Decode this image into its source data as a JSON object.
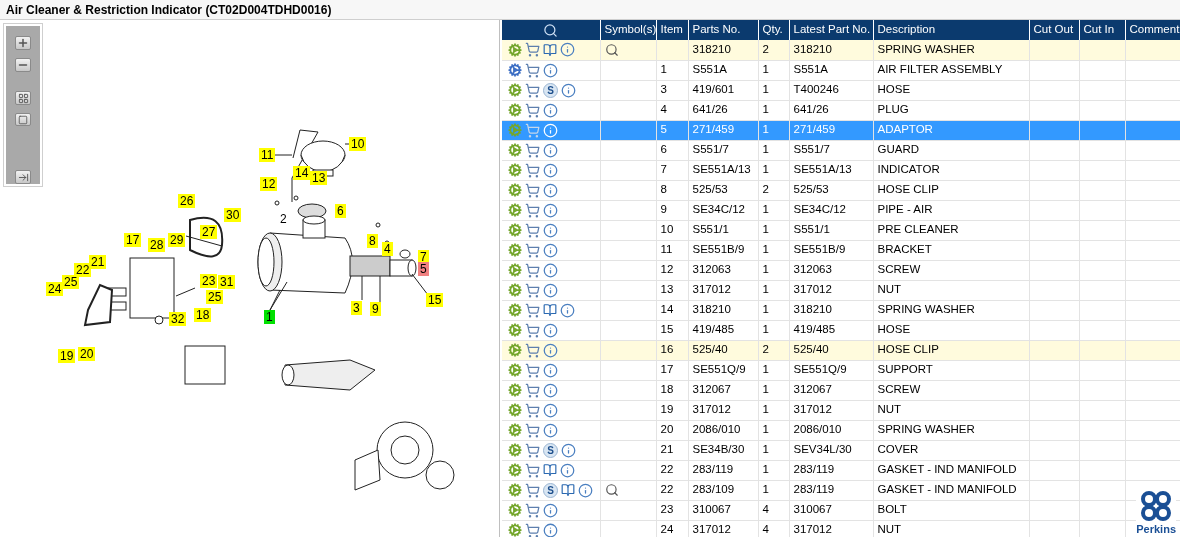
{
  "window": {
    "title": "Air Cleaner & Restriction Indicator (CT02D004TDHD0016)"
  },
  "diagram": {
    "callouts": [
      {
        "text": "10",
        "kind": "tag",
        "color": "#ffff00"
      },
      {
        "text": "11",
        "kind": "tag",
        "color": "#ffff00"
      },
      {
        "text": "12",
        "kind": "tag",
        "color": "#ffff00"
      },
      {
        "text": "14",
        "kind": "tag",
        "color": "#ffff00"
      },
      {
        "text": "13",
        "kind": "tag",
        "color": "#ffff00"
      },
      {
        "text": "6",
        "kind": "tag",
        "color": "#ffff00"
      },
      {
        "text": "2",
        "kind": "plain"
      },
      {
        "text": "26",
        "kind": "tag",
        "color": "#ffff00"
      },
      {
        "text": "30",
        "kind": "tag",
        "color": "#ffff00"
      },
      {
        "text": "27",
        "kind": "tag",
        "color": "#ffff00"
      },
      {
        "text": "29",
        "kind": "tag",
        "color": "#ffff00"
      },
      {
        "text": "28",
        "kind": "tag",
        "color": "#ffff00"
      },
      {
        "text": "17",
        "kind": "tag",
        "color": "#ffff00"
      },
      {
        "text": "21",
        "kind": "tag",
        "color": "#ffff00"
      },
      {
        "text": "22",
        "kind": "tag",
        "color": "#ffff00"
      },
      {
        "text": "25",
        "kind": "tag",
        "color": "#ffff00"
      },
      {
        "text": "24",
        "kind": "tag",
        "color": "#ffff00"
      },
      {
        "text": "23",
        "kind": "tag",
        "color": "#ffff00"
      },
      {
        "text": "31",
        "kind": "tag",
        "color": "#ffff00"
      },
      {
        "text": "25",
        "kind": "tag",
        "color": "#ffff00"
      },
      {
        "text": "18",
        "kind": "tag",
        "color": "#ffff00"
      },
      {
        "text": "32",
        "kind": "tag",
        "color": "#ffff00"
      },
      {
        "text": "19",
        "kind": "tag",
        "color": "#ffff00"
      },
      {
        "text": "20",
        "kind": "tag",
        "color": "#ffff00"
      },
      {
        "text": "8",
        "kind": "tag",
        "color": "#ffff00"
      },
      {
        "text": "4",
        "kind": "tag",
        "color": "#ffff00"
      },
      {
        "text": "7",
        "kind": "tag",
        "color": "#ffff00"
      },
      {
        "text": "5",
        "kind": "tag",
        "color": "#f08080"
      },
      {
        "text": "3",
        "kind": "tag",
        "color": "#ffff00"
      },
      {
        "text": "9",
        "kind": "tag",
        "color": "#ffff00"
      },
      {
        "text": "15",
        "kind": "tag",
        "color": "#ffff00"
      },
      {
        "text": "1",
        "kind": "tag",
        "color": "#00e000"
      }
    ]
  },
  "table": {
    "columns": [
      "Symbol(s)",
      "Item",
      "Parts No.",
      "Qty.",
      "Latest Part No.",
      "Description",
      "Cut Out",
      "Cut In",
      "Comment"
    ],
    "rows": [
      {
        "kind": "part",
        "book": true,
        "symbol": true,
        "highlighted": true,
        "selected": false,
        "parts_no": "318210",
        "qty": "2",
        "latest": "318210",
        "description": "SPRING WASHER"
      },
      {
        "kind": "assembly",
        "book": false,
        "symbol": false,
        "highlighted": false,
        "selected": false,
        "item": "1",
        "parts_no": "S551A",
        "qty": "1",
        "latest": "S551A",
        "description": "AIR FILTER ASSEMBLY"
      },
      {
        "kind": "part",
        "service": "S",
        "book": false,
        "symbol": false,
        "highlighted": false,
        "selected": false,
        "item": "3",
        "parts_no": "419/601",
        "qty": "1",
        "latest": "T400246",
        "description": "HOSE"
      },
      {
        "kind": "part",
        "book": false,
        "symbol": false,
        "highlighted": false,
        "selected": false,
        "item": "4",
        "parts_no": "641/26",
        "qty": "1",
        "latest": "641/26",
        "description": "PLUG"
      },
      {
        "kind": "part",
        "book": false,
        "symbol": false,
        "highlighted": false,
        "selected": true,
        "item": "5",
        "parts_no": "271/459",
        "qty": "1",
        "latest": "271/459",
        "description": "ADAPTOR"
      },
      {
        "kind": "part",
        "book": false,
        "symbol": false,
        "highlighted": false,
        "selected": false,
        "item": "6",
        "parts_no": "S551/7",
        "qty": "1",
        "latest": "S551/7",
        "description": "GUARD"
      },
      {
        "kind": "part",
        "book": false,
        "symbol": false,
        "highlighted": false,
        "selected": false,
        "item": "7",
        "parts_no": "SE551A/13",
        "qty": "1",
        "latest": "SE551A/13",
        "description": "INDICATOR"
      },
      {
        "kind": "part",
        "book": false,
        "symbol": false,
        "highlighted": false,
        "selected": false,
        "item": "8",
        "parts_no": "525/53",
        "qty": "2",
        "latest": "525/53",
        "description": "HOSE CLIP"
      },
      {
        "kind": "part",
        "book": false,
        "symbol": false,
        "highlighted": false,
        "selected": false,
        "item": "9",
        "parts_no": "SE34C/12",
        "qty": "1",
        "latest": "SE34C/12",
        "description": "PIPE - AIR"
      },
      {
        "kind": "part",
        "book": false,
        "symbol": false,
        "highlighted": false,
        "selected": false,
        "item": "10",
        "parts_no": "S551/1",
        "qty": "1",
        "latest": "S551/1",
        "description": "PRE CLEANER"
      },
      {
        "kind": "part",
        "book": false,
        "symbol": false,
        "highlighted": false,
        "selected": false,
        "item": "11",
        "parts_no": "SE551B/9",
        "qty": "1",
        "latest": "SE551B/9",
        "description": "BRACKET"
      },
      {
        "kind": "part",
        "book": false,
        "symbol": false,
        "highlighted": false,
        "selected": false,
        "item": "12",
        "parts_no": "312063",
        "qty": "1",
        "latest": "312063",
        "description": "SCREW"
      },
      {
        "kind": "part",
        "book": false,
        "symbol": false,
        "highlighted": false,
        "selected": false,
        "item": "13",
        "parts_no": "317012",
        "qty": "1",
        "latest": "317012",
        "description": "NUT"
      },
      {
        "kind": "part",
        "book": true,
        "symbol": false,
        "highlighted": false,
        "selected": false,
        "item": "14",
        "parts_no": "318210",
        "qty": "1",
        "latest": "318210",
        "description": "SPRING WASHER"
      },
      {
        "kind": "part",
        "book": false,
        "symbol": false,
        "highlighted": false,
        "selected": false,
        "item": "15",
        "parts_no": "419/485",
        "qty": "1",
        "latest": "419/485",
        "description": "HOSE"
      },
      {
        "kind": "part",
        "book": false,
        "symbol": false,
        "highlighted": true,
        "selected": false,
        "item": "16",
        "parts_no": "525/40",
        "qty": "2",
        "latest": "525/40",
        "description": "HOSE CLIP"
      },
      {
        "kind": "part",
        "book": false,
        "symbol": false,
        "highlighted": false,
        "selected": false,
        "item": "17",
        "parts_no": "SE551Q/9",
        "qty": "1",
        "latest": "SE551Q/9",
        "description": "SUPPORT"
      },
      {
        "kind": "part",
        "book": false,
        "symbol": false,
        "highlighted": false,
        "selected": false,
        "item": "18",
        "parts_no": "312067",
        "qty": "1",
        "latest": "312067",
        "description": "SCREW"
      },
      {
        "kind": "part",
        "book": false,
        "symbol": false,
        "highlighted": false,
        "selected": false,
        "item": "19",
        "parts_no": "317012",
        "qty": "1",
        "latest": "317012",
        "description": "NUT"
      },
      {
        "kind": "part",
        "book": false,
        "symbol": false,
        "highlighted": false,
        "selected": false,
        "item": "20",
        "parts_no": "2086/010",
        "qty": "1",
        "latest": "2086/010",
        "description": "SPRING WASHER"
      },
      {
        "kind": "part",
        "service": "S",
        "book": false,
        "symbol": false,
        "highlighted": false,
        "selected": false,
        "item": "21",
        "parts_no": "SE34B/30",
        "qty": "1",
        "latest": "SEV34L/30",
        "description": "COVER"
      },
      {
        "kind": "part",
        "book": true,
        "symbol": false,
        "highlighted": false,
        "selected": false,
        "item": "22",
        "parts_no": "283/119",
        "qty": "1",
        "latest": "283/119",
        "description": "GASKET - IND MANIFOLD"
      },
      {
        "kind": "part",
        "service": "S",
        "book": true,
        "symbol": true,
        "highlighted": false,
        "selected": false,
        "item": "22",
        "parts_no": "283/109",
        "qty": "1",
        "latest": "283/119",
        "description": "GASKET - IND MANIFOLD"
      },
      {
        "kind": "part",
        "book": false,
        "symbol": false,
        "highlighted": false,
        "selected": false,
        "item": "23",
        "parts_no": "310067",
        "qty": "4",
        "latest": "310067",
        "description": "BOLT"
      },
      {
        "kind": "part",
        "book": false,
        "symbol": false,
        "highlighted": false,
        "selected": false,
        "item": "24",
        "parts_no": "317012",
        "qty": "4",
        "latest": "317012",
        "description": "NUT"
      }
    ]
  },
  "logo": {
    "text": "Perkins"
  }
}
